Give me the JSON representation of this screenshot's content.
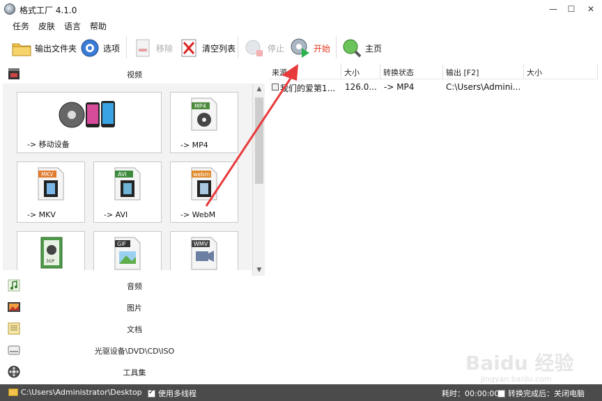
{
  "window": {
    "title": "格式工厂 4.1.0",
    "minimize": "—",
    "maximize": "☐",
    "close": "✕"
  },
  "menu": {
    "items": [
      "任务",
      "皮肤",
      "语言",
      "帮助"
    ]
  },
  "toolbar": {
    "output_folder": "输出文件夹",
    "options": "选项",
    "remove": "移除",
    "clear_list": "清空列表",
    "stop": "停止",
    "start": "开始",
    "home": "主页"
  },
  "categories": {
    "video": "视频",
    "audio": "音频",
    "image": "图片",
    "document": "文档",
    "optical": "光驱设备\\DVD\\CD\\ISO",
    "tools": "工具集"
  },
  "tiles": [
    {
      "label": "-> 移动设备",
      "badge": ""
    },
    {
      "label": "-> MP4",
      "badge": "MP4"
    },
    {
      "label": "-> MKV",
      "badge": "MKV"
    },
    {
      "label": "-> AVI",
      "badge": "AVI"
    },
    {
      "label": "-> WebM",
      "badge": "webm"
    },
    {
      "label": "",
      "badge": "3GP"
    },
    {
      "label": "",
      "badge": "GIF"
    },
    {
      "label": "",
      "badge": "WMV"
    }
  ],
  "table": {
    "headers": [
      "来源",
      "大小",
      "转换状态",
      "输出 [F2]",
      "大小"
    ],
    "rows": [
      {
        "source": "我们的爱第1...",
        "size": "126.0...",
        "status": "-> MP4",
        "output": "C:\\Users\\Admini..."
      }
    ]
  },
  "status": {
    "path": "C:\\Users\\Administrator\\Desktop",
    "multithread": "使用多线程",
    "elapsed": "耗时：00:00:00",
    "after_done": "转换完成后：关闭电脑"
  },
  "watermark": {
    "brand": "Baidu 经验",
    "url": "jingyan.baidu.com"
  },
  "colors": {
    "arrow": "#e8393b",
    "start_text": "#e0341a",
    "statusbar": "#4b4b4b"
  }
}
